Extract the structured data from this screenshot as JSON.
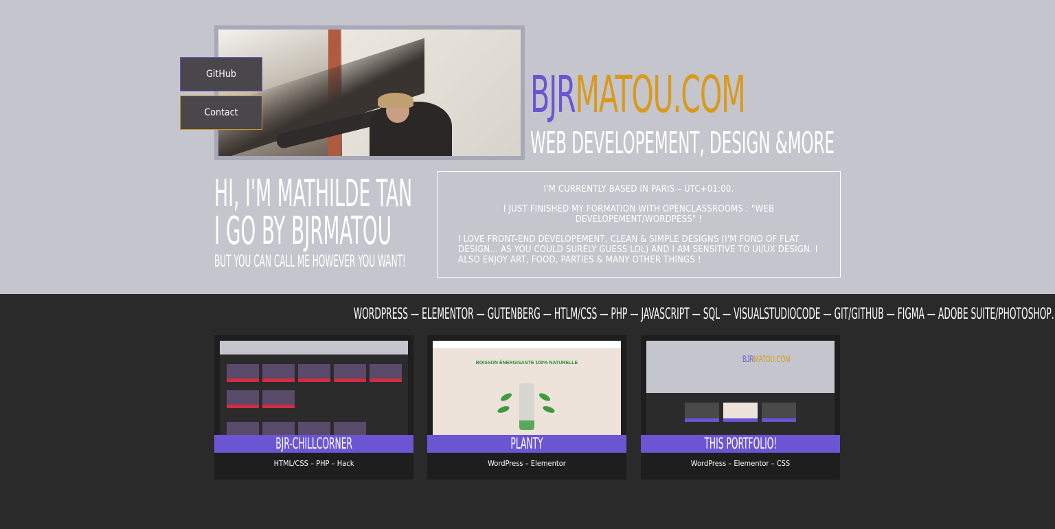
{
  "colors": {
    "accent_purple": "#6b55d3",
    "accent_gold": "#d99a1c",
    "hero_bg": "#c5c5cd",
    "dark_bg": "#2a2a2a"
  },
  "nav": {
    "github_label": "GitHub",
    "contact_label": "Contact"
  },
  "brand": {
    "part1": "BJR",
    "part2": "MATOU.COM",
    "tagline": "WEB DEVELOPEMENT, DESIGN &MORE"
  },
  "intro": {
    "line1": "HI, I'M MATHILDE TAN",
    "line2": "I GO BY BJRMATOU",
    "line3": "BUT YOU CAN CALL ME HOWEVER YOU WANT!"
  },
  "about": {
    "p1": "I'm currently based in Paris – UTC+01:00.",
    "p2": "I just finished my formation with OpenClassrooms : \"Web developement/Wordpess\" !",
    "p3": "I love front-end developement, clean & simple designs (I'm fond of flat design… as you could surely guess lol) and I am sensitive to UI/UX design. I also enjoy art, food, parties & many other things !"
  },
  "skills": "WORDPRESS — ELEMENTOR — GUTENBERG — HTLM/CSS — PHP — JAVASCRIPT — SQL — VISUALSTUDIOCODE — GIT/GITHUB — FIGMA — ADOBE SUITE/PHOTOSHOP…",
  "projects": [
    {
      "title": "BJR-CHILLCORNER",
      "tech": "HTML/CSS – PHP – Hack",
      "thumb_icon": "chillcorner-screenshot"
    },
    {
      "title": "PLANTY",
      "tech": "WordPress – Elementor",
      "thumb_icon": "planty-screenshot",
      "thumb_text": "BOISSON ÉNERGISANTE 100% NATURELLE"
    },
    {
      "title": "THIS PORTFOLIO!",
      "tech": "WordPress – Elementor – CSS",
      "thumb_icon": "portfolio-screenshot"
    }
  ]
}
